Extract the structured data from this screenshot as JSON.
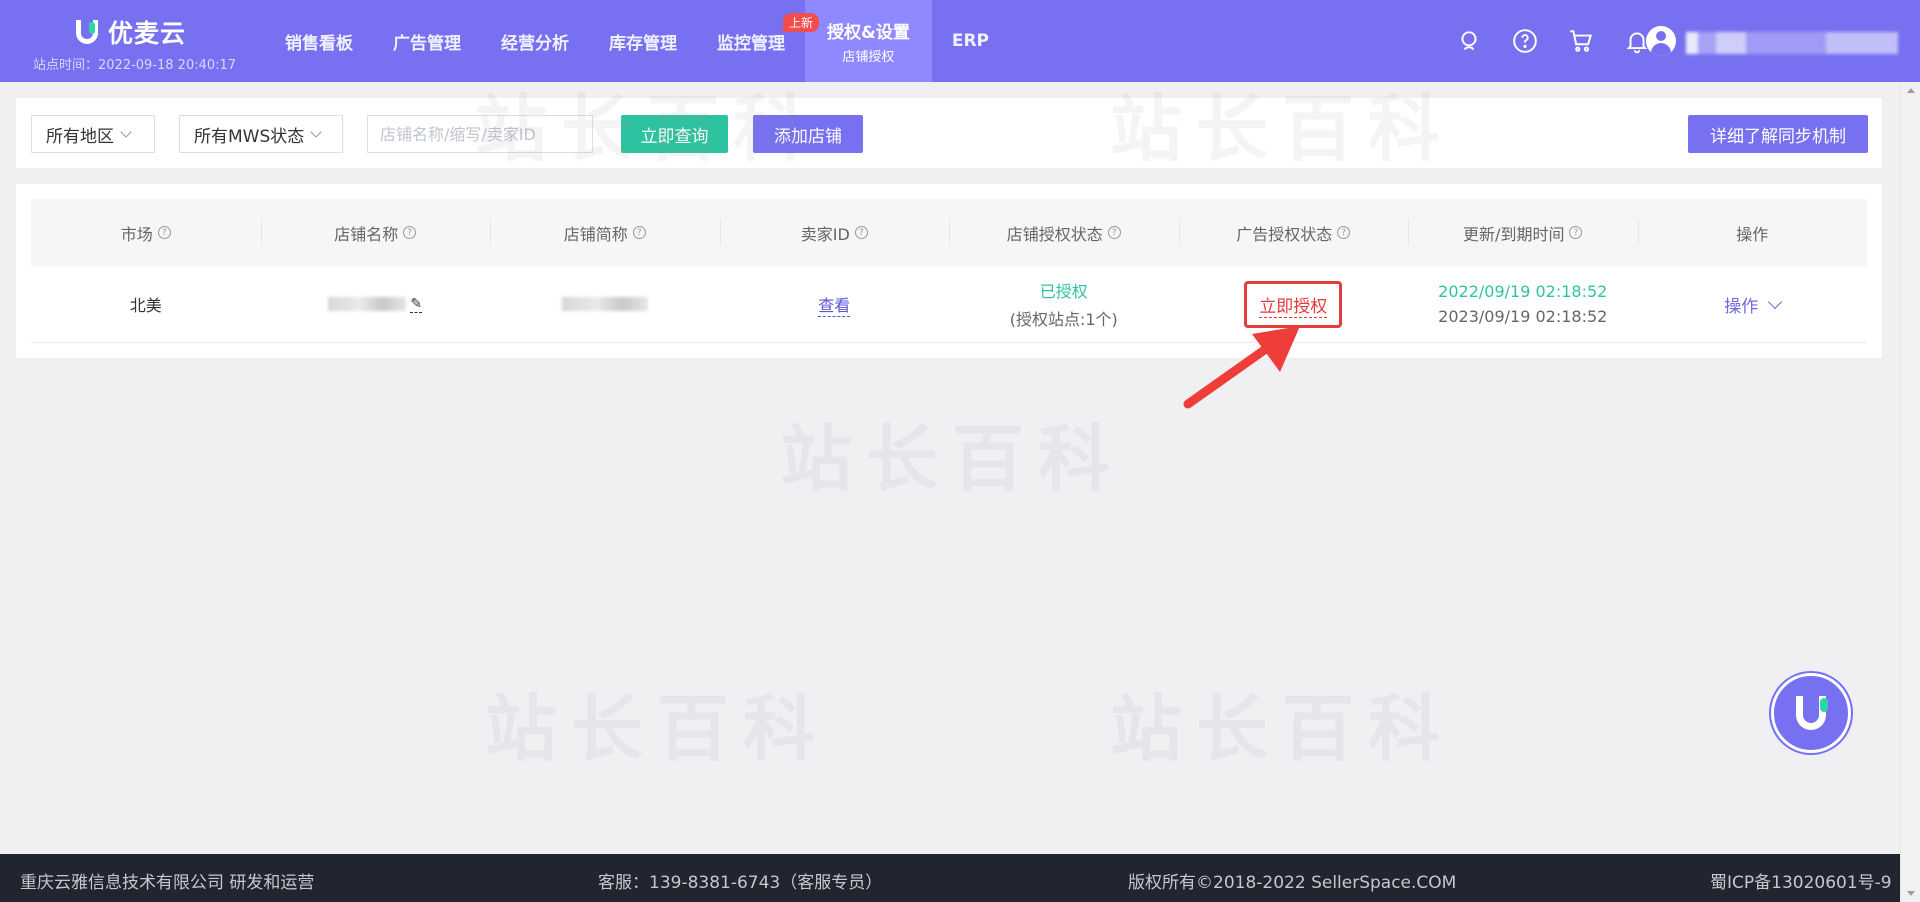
{
  "header": {
    "brand": "优麦云",
    "site_time": "站点时间：2022-09-18 20:40:17",
    "nav": [
      {
        "label": "销售看板"
      },
      {
        "label": "广告管理"
      },
      {
        "label": "经营分析"
      },
      {
        "label": "库存管理"
      },
      {
        "label": "监控管理"
      },
      {
        "label": "授权&设置",
        "sub": "店铺授权",
        "badge": "上新",
        "active": true
      },
      {
        "label": "ERP"
      }
    ]
  },
  "filters": {
    "region": "所有地区",
    "mws_status": "所有MWS状态",
    "search_placeholder": "店铺名称/缩写/卖家ID",
    "query_btn": "立即查询",
    "add_btn": "添加店铺",
    "sync_btn": "详细了解同步机制"
  },
  "table": {
    "headers": [
      "市场",
      "店铺名称",
      "店铺简称",
      "卖家ID",
      "店铺授权状态",
      "广告授权状态",
      "更新/到期时间",
      "操作"
    ],
    "rows": [
      {
        "market": "北美",
        "seller_id_link": "查看",
        "store_auth": "已授权",
        "store_auth_sub": "(授权站点:1个)",
        "ad_auth": "立即授权",
        "update_time": "2022/09/19 02:18:52",
        "expire_time": "2023/09/19 02:18:52",
        "action": "操作"
      }
    ]
  },
  "footer": {
    "company": "重庆云雅信息技术有限公司 研发和运营",
    "service": "客服：139-8381-6743（客服专员）",
    "copyright": "版权所有©2018-2022 SellerSpace.COM",
    "icp": "蜀ICP备13020601号-9"
  },
  "colors": {
    "brand": "#7770f1",
    "teal": "#2ec3a0",
    "alert": "#e53b3b",
    "footer_bg": "#21252f"
  }
}
